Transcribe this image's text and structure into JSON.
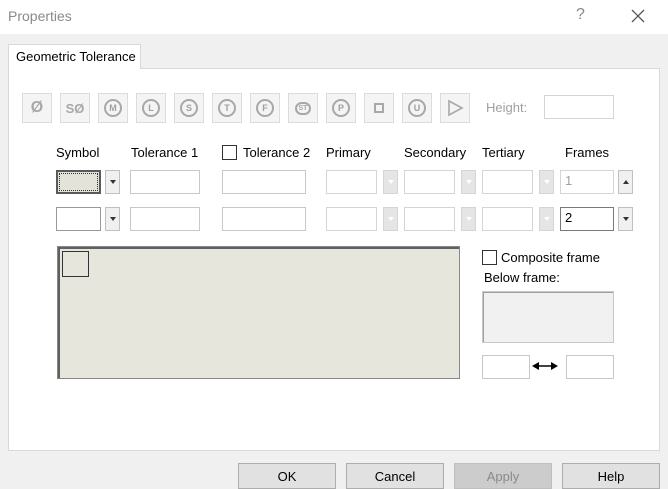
{
  "window": {
    "title": "Properties",
    "help": "?"
  },
  "tab": {
    "label": "Geometric Tolerance"
  },
  "symbols": {
    "diameter": "Ø",
    "spherical_diameter": "SØ",
    "max_material": "M",
    "least_material": "L",
    "regardless_feature_size": "S",
    "tangent_plane": "T",
    "free_state": "F",
    "statistical": "ST",
    "projected": "P",
    "unequal": "U"
  },
  "height": {
    "label": "Height:",
    "value": ""
  },
  "columns": {
    "symbol": "Symbol",
    "tolerance1": "Tolerance 1",
    "tolerance2": "Tolerance 2",
    "primary": "Primary",
    "secondary": "Secondary",
    "tertiary": "Tertiary",
    "frames": "Frames"
  },
  "rows": [
    {
      "tolerance1": "",
      "tolerance2": "",
      "primary": "",
      "secondary": "",
      "tertiary": "",
      "frames": "1"
    },
    {
      "tolerance1": "",
      "tolerance2": "",
      "primary": "",
      "secondary": "",
      "tertiary": "",
      "frames": "2"
    }
  ],
  "composite": {
    "label": "Composite frame",
    "checked": false
  },
  "below_frame": {
    "label": "Below frame:"
  },
  "spacing": {
    "left": "",
    "right": ""
  },
  "buttons": {
    "ok": "OK",
    "cancel": "Cancel",
    "apply": "Apply",
    "help": "Help"
  }
}
